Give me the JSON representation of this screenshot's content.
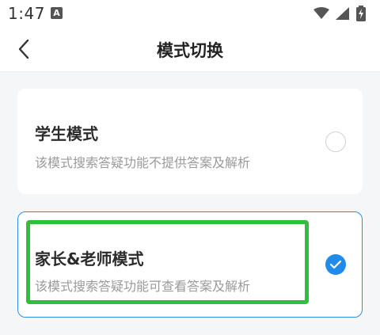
{
  "status_bar": {
    "time": "1:47",
    "notification_icon": "a-notification-icon",
    "icons": [
      "wifi-icon",
      "signal-icon",
      "battery-charging-icon"
    ]
  },
  "nav": {
    "back_icon": "chevron-left-icon",
    "title": "模式切换"
  },
  "modes": [
    {
      "title": "学生模式",
      "description": "该模式搜索答疑功能不提供答案及解析",
      "selected": false
    },
    {
      "title": "家长&老师模式",
      "description": "该模式搜索答疑功能可查看答案及解析",
      "selected": true
    }
  ],
  "colors": {
    "accent": "#1f8ceb",
    "selected_border": "#2f8fe6",
    "highlight": "#2fbf3b"
  }
}
